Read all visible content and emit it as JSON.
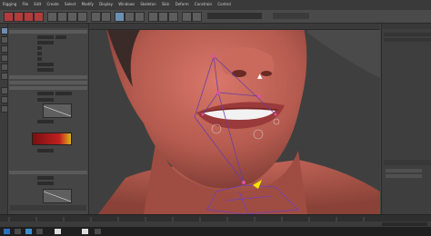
{
  "menubar": {
    "items": [
      "Rigging",
      "File",
      "Edit",
      "Create",
      "Select",
      "Modify",
      "Display",
      "Windows",
      "Skeleton",
      "Skin",
      "Deform",
      "Constrain",
      "Control"
    ]
  },
  "colors": {
    "accent": "#6b8fb3",
    "ramp_left": "#7a1010",
    "ramp_right": "#e0b020",
    "skin": "#b45a4e"
  },
  "icons": [
    "select-tool-icon",
    "move-tool-icon",
    "rotate-tool-icon",
    "scale-tool-icon",
    "paint-weights-icon",
    "snap-grid-icon"
  ]
}
